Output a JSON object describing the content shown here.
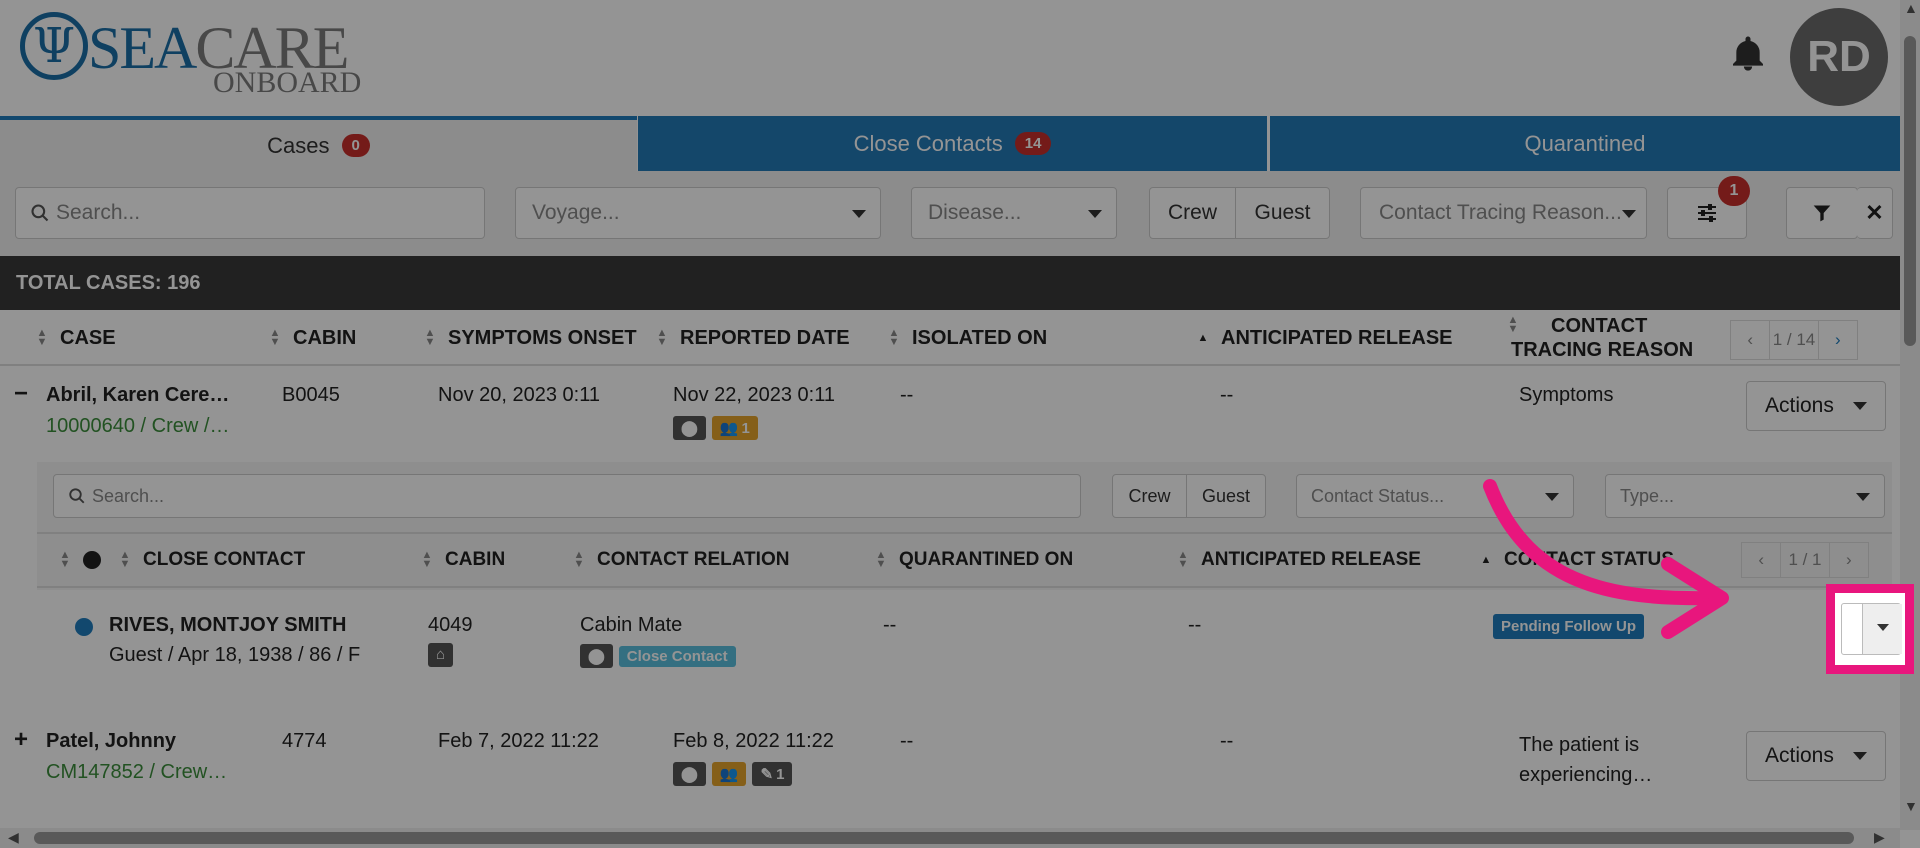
{
  "logo": {
    "sea": "SEA",
    "care": "CARE",
    "onboard": "ONBOARD"
  },
  "user": {
    "initials": "RD"
  },
  "tabs": [
    {
      "label": "Cases",
      "badge": "0"
    },
    {
      "label": "Close Contacts",
      "badge": "14"
    },
    {
      "label": "Quarantined"
    }
  ],
  "filters": {
    "search_placeholder": "Search...",
    "voyage_placeholder": "Voyage...",
    "disease_placeholder": "Disease...",
    "crew_label": "Crew",
    "guest_label": "Guest",
    "reason_placeholder": "Contact Tracing Reason...",
    "settings_badge": "1"
  },
  "total": "TOTAL CASES: 196",
  "columns": {
    "case": "CASE",
    "cabin": "CABIN",
    "symptoms_onset": "SYMPTOMS ONSET",
    "reported_date": "REPORTED DATE",
    "isolated_on": "ISOLATED ON",
    "anticipated_release": "ANTICIPATED RELEASE",
    "contact_tracing_reason_line1": "CONTACT",
    "contact_tracing_reason_line2": "TRACING REASON"
  },
  "pager": {
    "prev": "‹",
    "page": "1 / 14",
    "next": "›"
  },
  "cases": [
    {
      "toggle": "−",
      "name": "Abril, Karen Cere…",
      "id_line": "10000640 / Crew /…",
      "cabin": "B0045",
      "symptoms_onset": "Nov 20, 2023 0:11",
      "reported_date": "Nov 22, 2023 0:11",
      "contacts_count": "1",
      "isolated_on": "--",
      "anticipated_release": "--",
      "reason": "Symptoms",
      "actions_label": "Actions"
    },
    {
      "toggle": "+",
      "name": "Patel, Johnny",
      "id_line": "CM147852 / Crew…",
      "cabin": "4774",
      "symptoms_onset": "Feb 7, 2022 11:22",
      "reported_date": "Feb 8, 2022 11:22",
      "attachments_count": "1",
      "isolated_on": "--",
      "anticipated_release": "--",
      "reason_line1": "The patient is",
      "reason_line2": "experiencing…",
      "actions_label": "Actions"
    }
  ],
  "subtable": {
    "search_placeholder": "Search...",
    "crew_label": "Crew",
    "guest_label": "Guest",
    "status_placeholder": "Contact Status...",
    "type_placeholder": "Type...",
    "columns": {
      "close_contact": "CLOSE CONTACT",
      "cabin": "CABIN",
      "contact_relation": "CONTACT RELATION",
      "quarantined_on": "QUARANTINED ON",
      "anticipated_release": "ANTICIPATED RELEASE",
      "contact_status": "CONTACT STATUS"
    },
    "pager": {
      "prev": "‹",
      "page": "1 / 1",
      "next": "›"
    },
    "rows": [
      {
        "name": "RIVES, MONTJOY SMITH",
        "details": "Guest / Apr 18, 1938 / 86 / F",
        "cabin": "4049",
        "relation": "Cabin Mate",
        "relation_badge": "Close Contact",
        "quarantined_on": "--",
        "anticipated_release": "--",
        "status": "Pending Follow Up"
      }
    ]
  },
  "colors": {
    "accent": "#237ab7",
    "highlight": "#e8167d",
    "badge": "#c9302c",
    "status": "#1f7dbd"
  }
}
